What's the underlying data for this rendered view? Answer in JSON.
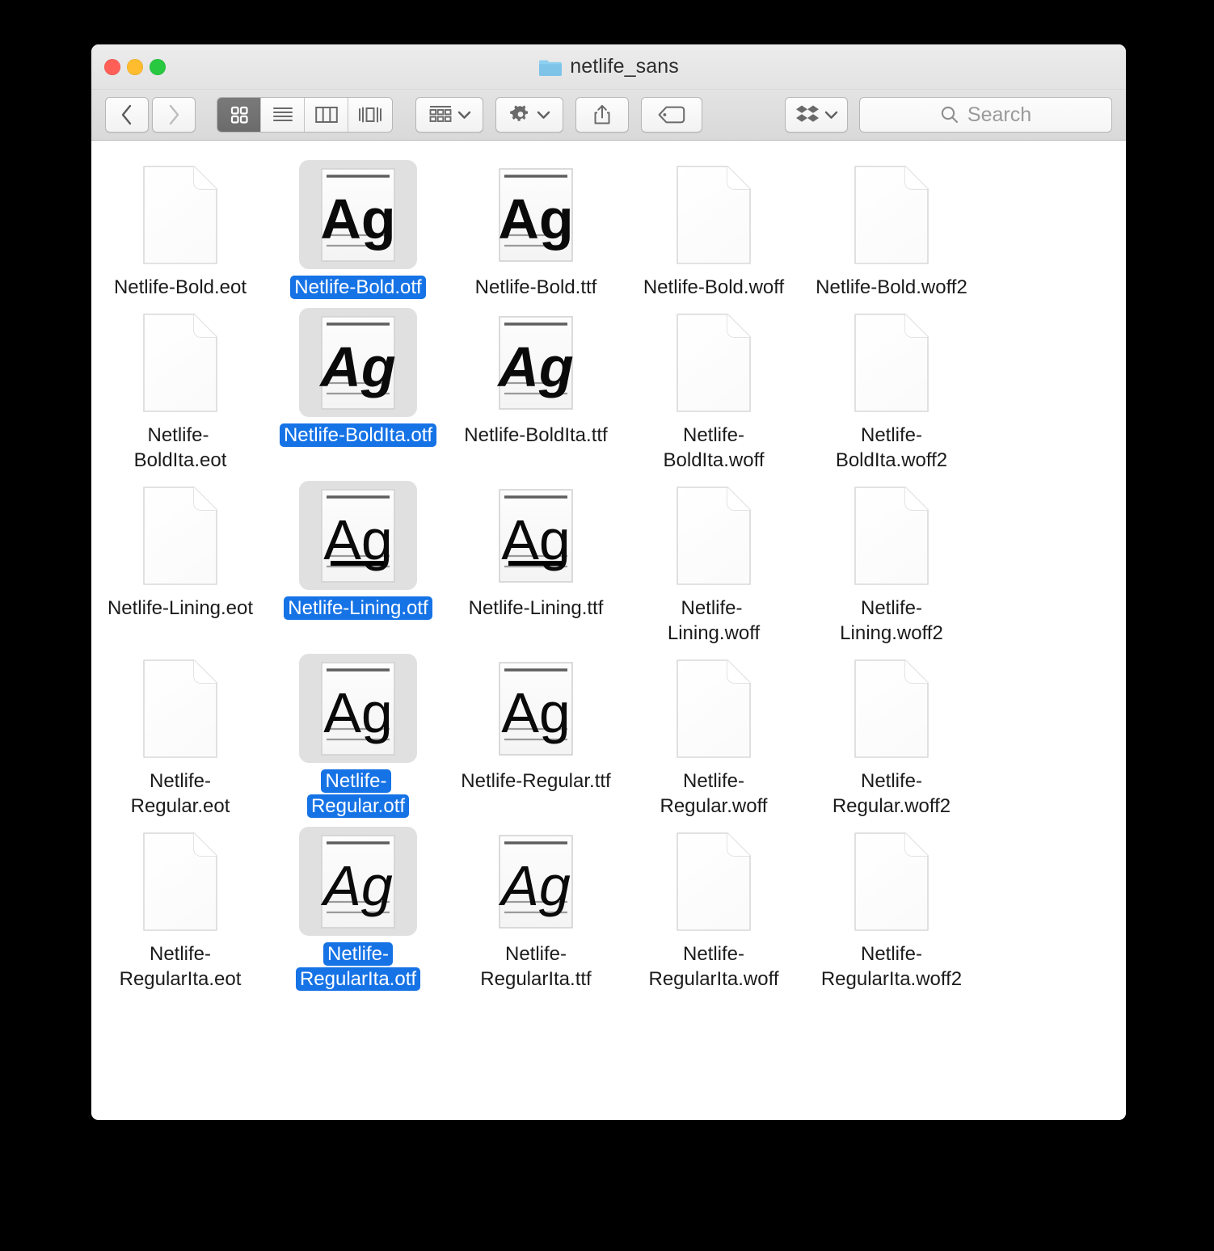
{
  "window": {
    "title": "netlife_sans",
    "folder_icon": "folder-icon",
    "traffic_lights": [
      {
        "name": "close-button",
        "color": "#ff5f57"
      },
      {
        "name": "minimize-button",
        "color": "#febc2e"
      },
      {
        "name": "maximize-button",
        "color": "#28c840"
      }
    ]
  },
  "toolbar": {
    "back_icon": "chevron-left-icon",
    "forward_icon": "chevron-right-icon",
    "view_modes": [
      {
        "name": "icon-view",
        "icon": "grid-icon",
        "active": true
      },
      {
        "name": "list-view",
        "icon": "list-icon",
        "active": false
      },
      {
        "name": "column-view",
        "icon": "columns-icon",
        "active": false
      },
      {
        "name": "gallery-view",
        "icon": "coverflow-icon",
        "active": false
      }
    ],
    "arrange_icon": "arrange-grid-icon",
    "action_icon": "gear-icon",
    "share_icon": "share-icon",
    "tag_icon": "tag-icon",
    "dropbox_icon": "dropbox-icon",
    "chevron_icon": "chevron-down-icon",
    "search": {
      "icon": "search-icon",
      "placeholder": "Search",
      "value": ""
    }
  },
  "colors": {
    "selection_blue": "#1673e6",
    "selected_icon_bg": "#e0e0e0",
    "folder_blue": "#7ecbf0",
    "window_chrome": "#e3e3e3"
  },
  "content": {
    "view": "icon",
    "rows": [
      {
        "cells": [
          {
            "label": "Netlife-Bold.eot",
            "icon": "blank-document-icon",
            "selected": false
          },
          {
            "label": "Netlife-Bold.otf",
            "icon": "font-preview-icon",
            "selected": true,
            "style": "bold"
          },
          {
            "label": "Netlife-Bold.ttf",
            "icon": "font-preview-icon",
            "selected": false,
            "style": "bold"
          },
          {
            "label": "Netlife-Bold.woff",
            "icon": "blank-document-icon",
            "selected": false
          },
          {
            "label": "Netlife-Bold.woff2",
            "icon": "blank-document-icon",
            "selected": false
          }
        ]
      },
      {
        "cells": [
          {
            "label": "Netlife-BoldIta.eot",
            "icon": "blank-document-icon",
            "selected": false
          },
          {
            "label": "Netlife-BoldIta.otf",
            "icon": "font-preview-icon",
            "selected": true,
            "style": "bolditalic"
          },
          {
            "label": "Netlife-BoldIta.ttf",
            "icon": "font-preview-icon",
            "selected": false,
            "style": "bolditalic"
          },
          {
            "label": "Netlife-BoldIta.woff",
            "icon": "blank-document-icon",
            "selected": false
          },
          {
            "label": "Netlife-BoldIta.woff2",
            "icon": "blank-document-icon",
            "selected": false
          }
        ]
      },
      {
        "cells": [
          {
            "label": "Netlife-Lining.eot",
            "icon": "blank-document-icon",
            "selected": false
          },
          {
            "label": "Netlife-Lining.otf",
            "icon": "font-preview-icon",
            "selected": true,
            "style": "lining"
          },
          {
            "label": "Netlife-Lining.ttf",
            "icon": "font-preview-icon",
            "selected": false,
            "style": "lining"
          },
          {
            "label": "Netlife-Lining.woff",
            "icon": "blank-document-icon",
            "selected": false
          },
          {
            "label": "Netlife-Lining.woff2",
            "icon": "blank-document-icon",
            "selected": false
          }
        ]
      },
      {
        "cells": [
          {
            "label": "Netlife-Regular.eot",
            "icon": "blank-document-icon",
            "selected": false
          },
          {
            "label": "Netlife-Regular.otf",
            "icon": "font-preview-icon",
            "selected": true,
            "style": "regular"
          },
          {
            "label": "Netlife-Regular.ttf",
            "icon": "font-preview-icon",
            "selected": false,
            "style": "regular"
          },
          {
            "label": "Netlife-Regular.woff",
            "icon": "blank-document-icon",
            "selected": false
          },
          {
            "label": "Netlife-Regular.woff2",
            "icon": "blank-document-icon",
            "selected": false
          }
        ]
      },
      {
        "cells": [
          {
            "label": "Netlife-RegularIta.eot",
            "icon": "blank-document-icon",
            "selected": false
          },
          {
            "label": "Netlife-RegularIta.otf",
            "icon": "font-preview-icon",
            "selected": true,
            "style": "italic"
          },
          {
            "label": "Netlife-RegularIta.ttf",
            "icon": "font-preview-icon",
            "selected": false,
            "style": "italic"
          },
          {
            "label": "Netlife-RegularIta.woff",
            "icon": "blank-document-icon",
            "selected": false
          },
          {
            "label": "Netlife-RegularIta.woff2",
            "icon": "blank-document-icon",
            "selected": false
          }
        ]
      }
    ],
    "preview_glyphs": "Ag"
  }
}
